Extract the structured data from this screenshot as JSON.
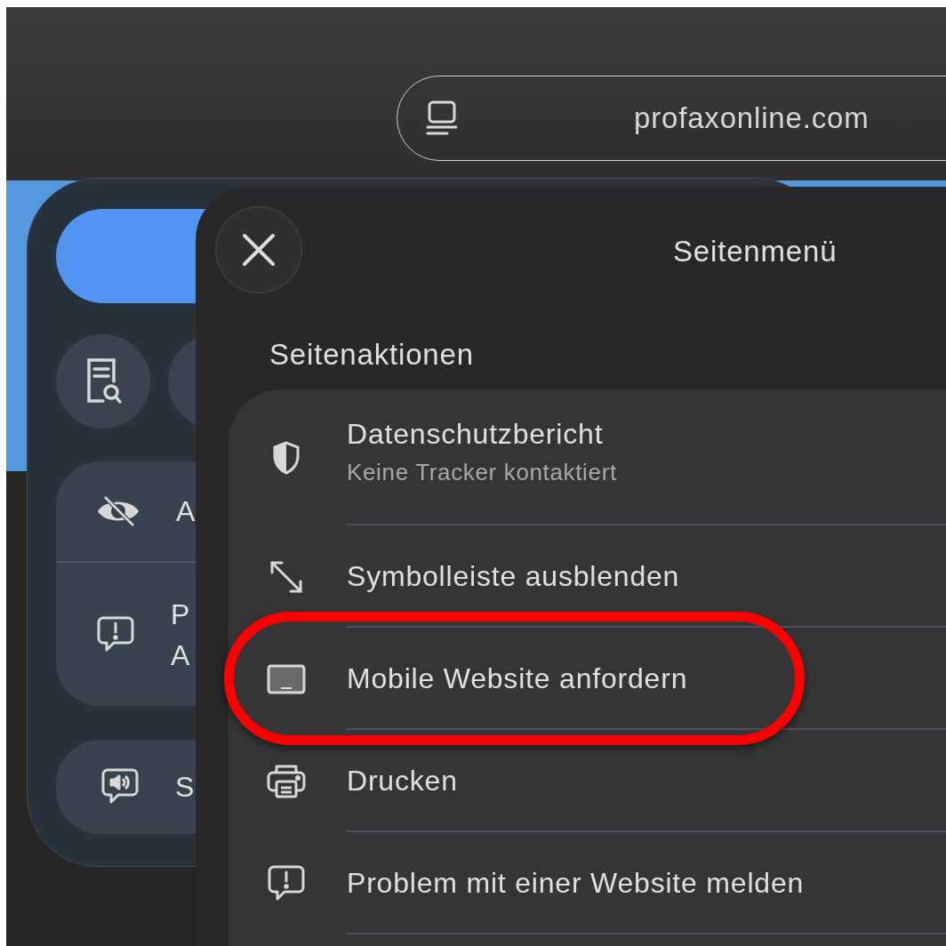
{
  "address_bar": {
    "url": "profaxonline.com"
  },
  "back_panel": {
    "rows": [
      {
        "kind": "eye-slash",
        "lines": [
          "A"
        ]
      },
      {
        "kind": "report",
        "lines": [
          "P",
          "A"
        ]
      }
    ],
    "footer_row": {
      "kind": "speaker",
      "lines": [
        "S"
      ]
    }
  },
  "menu": {
    "title": "Seitenmenü",
    "section": "Seitenaktionen",
    "items": [
      {
        "kind": "shield",
        "label": "Datenschutzbericht",
        "subtitle": "Keine Tracker kontaktiert",
        "highlighted": false
      },
      {
        "kind": "expand",
        "label": "Symbolleiste ausblenden",
        "highlighted": false
      },
      {
        "kind": "laptop",
        "label": "Mobile Website anfordern",
        "highlighted": true
      },
      {
        "kind": "printer",
        "label": "Drucken",
        "highlighted": false
      },
      {
        "kind": "report",
        "label": "Problem mit einer Website melden",
        "highlighted": false
      }
    ]
  }
}
